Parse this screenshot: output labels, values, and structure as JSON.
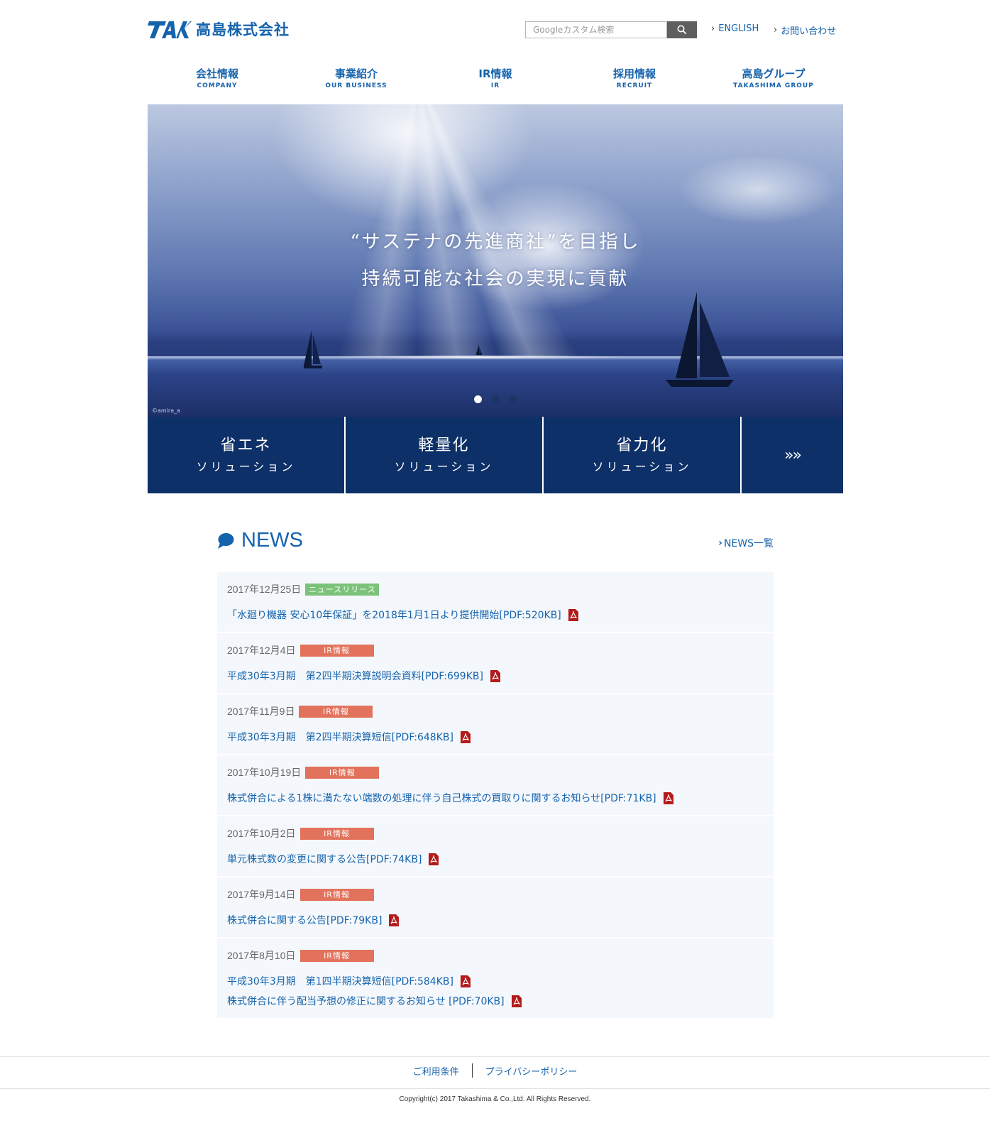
{
  "header": {
    "logo_mark": "TAK",
    "logo_text": "高島株式会社",
    "search_placeholder": "Googleカスタム検索",
    "english_link": "ENGLISH",
    "contact_link": "お問い合わせ"
  },
  "nav": [
    {
      "ja": "会社情報",
      "en": "COMPANY"
    },
    {
      "ja": "事業紹介",
      "en": "OUR BUSINESS"
    },
    {
      "ja": "IR情報",
      "en": "IR"
    },
    {
      "ja": "採用情報",
      "en": "RECRUIT"
    },
    {
      "ja": "高島グループ",
      "en": "TAKASHIMA GROUP"
    }
  ],
  "hero": {
    "line1": "“サステナの先進商社”を目指し",
    "line2": "持続可能な社会の実現に貢献",
    "credit": "©amira_a",
    "slides": 3,
    "active_slide": 1
  },
  "tiles": [
    {
      "title": "省エネ",
      "sub": "ソリューション"
    },
    {
      "title": "軽量化",
      "sub": "ソリューション"
    },
    {
      "title": "省力化",
      "sub": "ソリューション"
    },
    {
      "more": "»»"
    }
  ],
  "news": {
    "title": "NEWS",
    "all_link": "NEWS一覧",
    "items": [
      {
        "date": "2017年12月25日",
        "category": "ニュースリリース",
        "links": [
          "「水廻り機器 安心10年保証」を2018年1月1日より提供開始[PDF:520KB]"
        ]
      },
      {
        "date": "2017年12月4日",
        "category": "IR情報",
        "links": [
          "平成30年3月期　第2四半期決算説明会資料[PDF:699KB]"
        ]
      },
      {
        "date": "2017年11月9日",
        "category": "IR情報",
        "links": [
          "平成30年3月期　第2四半期決算短信[PDF:648KB]"
        ]
      },
      {
        "date": "2017年10月19日",
        "category": "IR情報",
        "links": [
          "株式併合による1株に満たない端数の処理に伴う自己株式の買取りに関するお知らせ[PDF:71KB]"
        ]
      },
      {
        "date": "2017年10月2日",
        "category": "IR情報",
        "links": [
          "単元株式数の変更に関する公告[PDF:74KB]"
        ]
      },
      {
        "date": "2017年9月14日",
        "category": "IR情報",
        "links": [
          "株式併合に関する公告[PDF:79KB]"
        ]
      },
      {
        "date": "2017年8月10日",
        "category": "IR情報",
        "links": [
          "平成30年3月期　第1四半期決算短信[PDF:584KB]",
          "株式併合に伴う配当予想の修正に関するお知らせ [PDF:70KB]"
        ]
      }
    ]
  },
  "footer": {
    "terms": "ご利用条件",
    "privacy": "プライバシーポリシー",
    "copyright": "Copyright(c) 2017 Takashima & Co.,Ltd. All Rights Reserved."
  },
  "colors": {
    "brand_blue": "#1663ad",
    "tile_navy": "#0e3068",
    "badge_ir": "#e2725b",
    "badge_news": "#7cc27a"
  }
}
